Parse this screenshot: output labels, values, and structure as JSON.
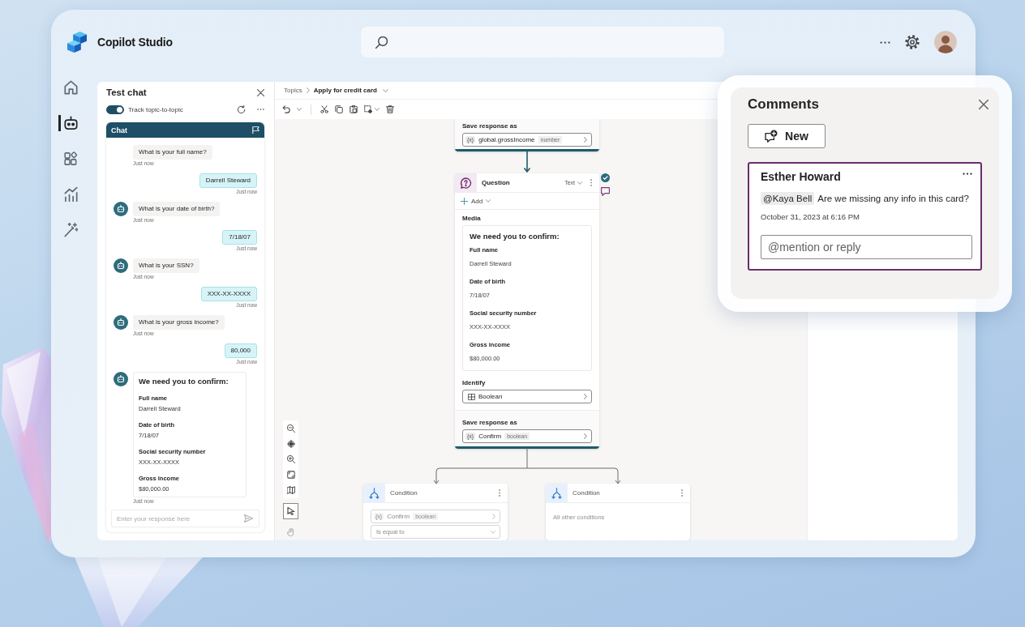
{
  "app": {
    "name": "Copilot Studio"
  },
  "rail": [
    {
      "kind": "home",
      "selected": false
    },
    {
      "kind": "agents",
      "selected": true
    },
    {
      "kind": "apps",
      "selected": false
    },
    {
      "kind": "analytics",
      "selected": false
    },
    {
      "kind": "wand",
      "selected": false
    }
  ],
  "test_chat": {
    "title": "Test chat",
    "toggle": {
      "label": "Track topic-to-topic",
      "on": true
    },
    "chat_title": "Chat",
    "messages": [
      {
        "kind": "bot",
        "avatar": false,
        "text": "What is your full name?",
        "time": "Just now"
      },
      {
        "kind": "user",
        "text": "Darrell Steward",
        "time": "Just now"
      },
      {
        "kind": "bot",
        "avatar": true,
        "text": "What is your date of birth?",
        "time": "Just now"
      },
      {
        "kind": "user",
        "text": "7/18/07",
        "time": "Just now"
      },
      {
        "kind": "bot",
        "avatar": true,
        "text": "What is your SSN?",
        "time": "Just now"
      },
      {
        "kind": "user",
        "text": "XXX-XX-XXXX",
        "time": "Just now"
      },
      {
        "kind": "bot",
        "avatar": true,
        "text": "What is your gross income?",
        "time": "Just now"
      },
      {
        "kind": "user",
        "text": "80,000",
        "time": "Just now"
      },
      {
        "kind": "card",
        "avatar": true,
        "title": "We need you to confirm:",
        "fields": [
          {
            "label": "Full name",
            "value": "Darrell Steward"
          },
          {
            "label": "Date of birth",
            "value": "7/18/07"
          },
          {
            "label": "Social security number",
            "value": "XXX-XX-XXXX"
          },
          {
            "label": "Gross income",
            "value": "$80,000.00"
          }
        ],
        "time": "Just now"
      }
    ],
    "input_placeholder": "Enter your response here"
  },
  "topic": {
    "breadcrumb": [
      {
        "label": "Topics",
        "current": false
      },
      {
        "label": "Apply for credit card",
        "current": true
      }
    ]
  },
  "canvas": {
    "top_node": {
      "label": "Save response as",
      "field": {
        "glyph": "{x}",
        "variable": "global.grossIncome",
        "type": "number"
      }
    },
    "question": {
      "title": "Question",
      "mode": "Text",
      "add": "Add",
      "valid": true,
      "commented": true,
      "media_label": "Media",
      "media_card": {
        "title": "We need you to confirm:",
        "fields": [
          {
            "label": "Full name",
            "value": "Darrell Steward"
          },
          {
            "label": "Date of birth",
            "value": "7/18/07"
          },
          {
            "label": "Social security number",
            "value": "XXX-XX-XXXX"
          },
          {
            "label": "Gross income",
            "value": "$80,000.00"
          }
        ]
      },
      "identify_label": "Identify",
      "identify_value": "Boolean",
      "save_label": "Save response as",
      "save_field": {
        "glyph": "{x}",
        "variable": "Confirm",
        "type": "boolean"
      }
    },
    "conditions": [
      {
        "kind": "expression",
        "title": "Condition",
        "field": {
          "glyph": "{x}",
          "variable": "Confirm",
          "type": "boolean"
        },
        "operator": "Is equal to"
      },
      {
        "kind": "else",
        "title": "Condition",
        "text": "All other conditions"
      }
    ],
    "mode_tools": [
      {
        "kind": "pointer",
        "selected": true
      },
      {
        "kind": "hand",
        "selected": false
      }
    ]
  },
  "comments": {
    "title": "Comments",
    "new_label": "New",
    "items": [
      {
        "author": "Esther Howard",
        "mention": "@Kaya Bell",
        "text": "Are we missing any info in this card?",
        "time": "October 31, 2023 at 6:16 PM",
        "reply_placeholder": "@mention or reply",
        "selected": true
      }
    ]
  }
}
